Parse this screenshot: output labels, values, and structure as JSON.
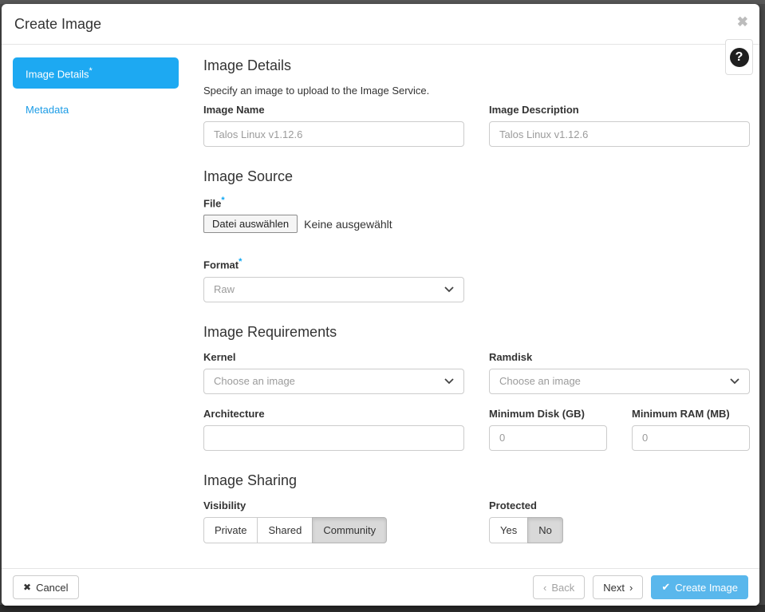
{
  "modal": {
    "title": "Create Image"
  },
  "icons": {
    "close": "✖",
    "help": "?",
    "cancel_x": "✖",
    "check": "✔",
    "back_chevron": "‹",
    "next_chevron": "›"
  },
  "sidebar": {
    "items": [
      {
        "label": "Image Details",
        "required": "*",
        "active": true
      },
      {
        "label": "Metadata",
        "required": "",
        "active": false
      }
    ]
  },
  "sections": {
    "details": {
      "heading": "Image Details",
      "description": "Specify an image to upload to the Image Service.",
      "image_name": {
        "label": "Image Name",
        "value": "Talos Linux v1.12.6"
      },
      "image_description": {
        "label": "Image Description",
        "value": "Talos Linux v1.12.6"
      }
    },
    "source": {
      "heading": "Image Source",
      "file": {
        "label": "File",
        "required": "*",
        "button_label": "Datei auswählen",
        "status": "Keine ausgewählt"
      },
      "format": {
        "label": "Format",
        "required": "*",
        "value": "Raw"
      }
    },
    "requirements": {
      "heading": "Image Requirements",
      "kernel": {
        "label": "Kernel",
        "value": "Choose an image"
      },
      "ramdisk": {
        "label": "Ramdisk",
        "value": "Choose an image"
      },
      "architecture": {
        "label": "Architecture",
        "value": ""
      },
      "min_disk": {
        "label": "Minimum Disk (GB)",
        "value": "0"
      },
      "min_ram": {
        "label": "Minimum RAM (MB)",
        "value": "0"
      }
    },
    "sharing": {
      "heading": "Image Sharing",
      "visibility": {
        "label": "Visibility",
        "options": [
          "Private",
          "Shared",
          "Community"
        ],
        "selected": "Community"
      },
      "protected": {
        "label": "Protected",
        "options": [
          "Yes",
          "No"
        ],
        "selected": "No"
      }
    }
  },
  "footer": {
    "cancel": "Cancel",
    "back": "Back",
    "next": "Next",
    "create": "Create Image"
  },
  "colors": {
    "accent_blue": "#1da9f2",
    "primary_button": "#59b7ec",
    "required_asterisk": "#0da6f2",
    "active_toggle_bg": "#d9d9d9"
  }
}
